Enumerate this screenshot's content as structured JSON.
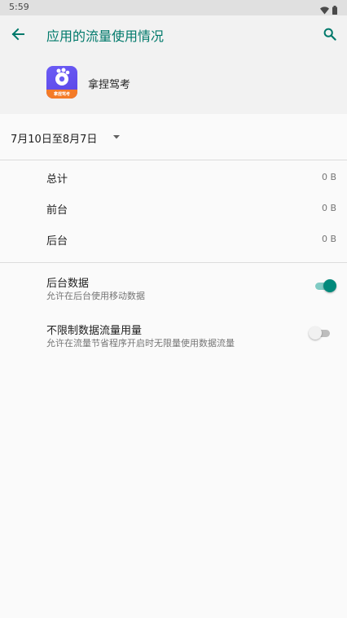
{
  "status_bar": {
    "time": "5:59",
    "icons": [
      "wifi-icon",
      "battery-icon"
    ]
  },
  "app_bar": {
    "title": "应用的流量使用情况",
    "icons": [
      "back-arrow-icon",
      "search-icon"
    ],
    "accent_color": "#00796b"
  },
  "app_info": {
    "name": "拿捏驾考",
    "logo_text": "拿捏驾考",
    "logo_colors": [
      "#6b5cf5",
      "#f47b28"
    ]
  },
  "period": {
    "label": "7月10日至8月7日",
    "icon": "dropdown-arrow-icon"
  },
  "usage": [
    {
      "label": "总计",
      "value": "0 B"
    },
    {
      "label": "前台",
      "value": "0 B"
    },
    {
      "label": "后台",
      "value": "0 B"
    }
  ],
  "settings": [
    {
      "title": "后台数据",
      "subtitle": "允许在后台使用移动数据",
      "enabled": true
    },
    {
      "title": "不限制数据流量用量",
      "subtitle": "允许在流量节省程序开启时无限量使用数据流量",
      "enabled": false
    }
  ]
}
